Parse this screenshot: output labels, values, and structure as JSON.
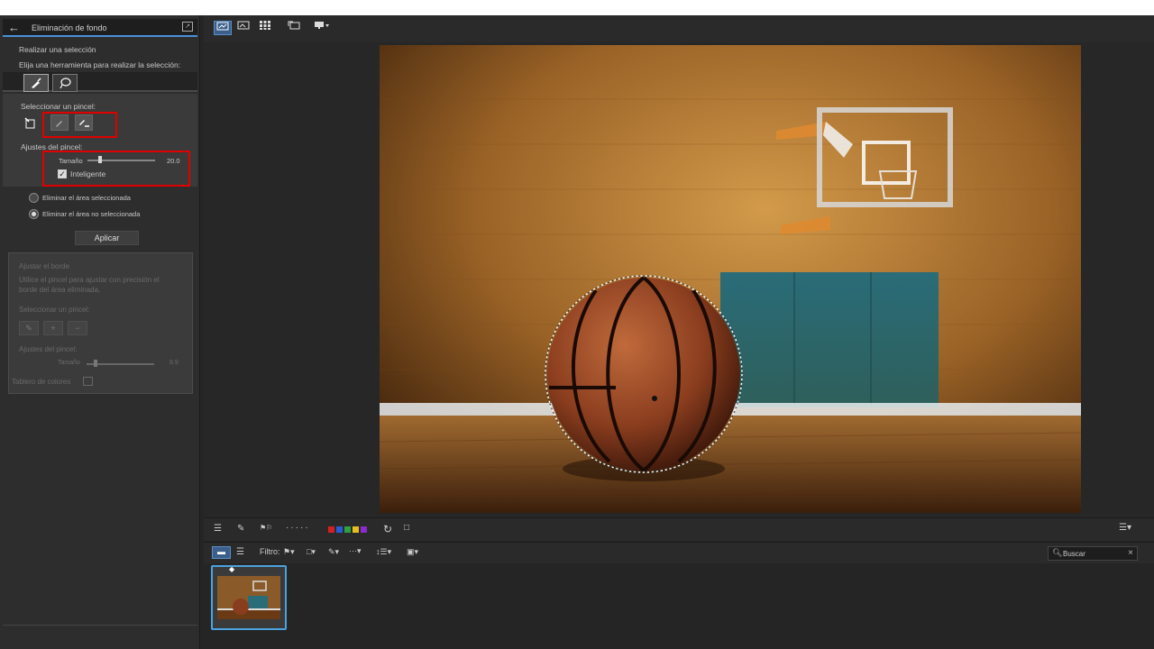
{
  "panel": {
    "title": "Eliminación de fondo",
    "back_icon": "arrow-left-icon",
    "section_title": "Realizar una selección",
    "instruction": "Elija una herramienta para realizar la selección:",
    "select_brush_label": "Seleccionar un pincel:",
    "brush_settings_label": "Ajustes del pincel:",
    "size_label": "Tamaño",
    "size_value": "20.0",
    "smart_label": "Inteligente",
    "smart_checked": true,
    "option_remove_selected": "Eliminar el área seleccionada",
    "option_remove_unselected": "Eliminar el área no seleccionada",
    "selected_option": "option_remove_unselected",
    "apply_label": "Aplicar",
    "highlight_color": "#e00000"
  },
  "edge_panel": {
    "title": "Ajustar el borde",
    "description_line1": "Utilice el pincel para ajustar con precisión el",
    "description_line2": "borde del área eliminada.",
    "select_brush_label": "Seleccionar un pincel:",
    "brush_settings_label": "Ajustes del pincel:",
    "size_label": "Tamaño",
    "size_value": "8.9",
    "color_board_label": "Tablero de colores"
  },
  "toolbar": {
    "icons": [
      "compare-view-icon",
      "single-view-icon",
      "grid-view-icon",
      "rotate-screen-icon",
      "monitor-icon"
    ]
  },
  "bottom_toolbar": {
    "colors": [
      "#d42020",
      "#2a5bd7",
      "#2ea040",
      "#e2c020",
      "#8a2ad0"
    ]
  },
  "filter_bar": {
    "filter_label": "Filtro:",
    "search_placeholder": "Buscar"
  },
  "accent_color": "#4aa3e0"
}
